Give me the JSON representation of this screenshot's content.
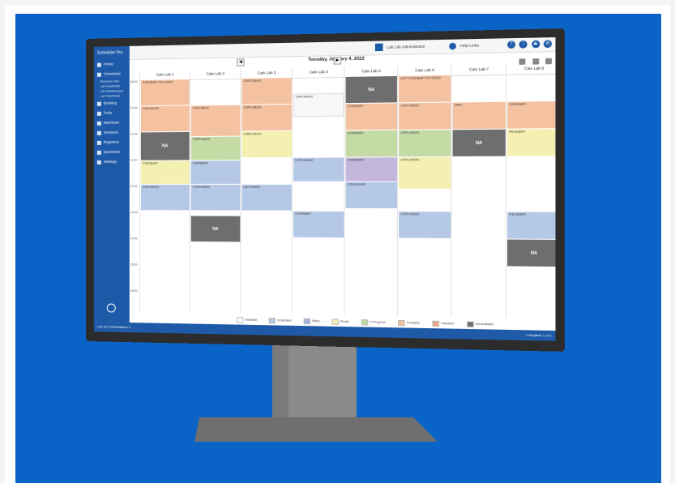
{
  "colors": {
    "backdrop": "#0a64c8",
    "sidebar": "#1e5aa8",
    "orange": "#f4c2a0",
    "green": "#c4dba6",
    "yellow": "#f3f0b1",
    "blue": "#b5c8e6",
    "purple": "#c4b7dc",
    "gray_na": "#6e6e6e"
  },
  "app": {
    "logo": "Scheduler Pro",
    "user_label": "Lab Lab Administrator",
    "help_label": "Help Links",
    "top_icons": [
      "?",
      "i",
      "⏏",
      "⚙"
    ]
  },
  "sidebar": {
    "items": [
      {
        "label": "Home",
        "icon": "home-icon"
      },
      {
        "label": "Schedules",
        "icon": "calendar-icon"
      },
      {
        "label": "Booking",
        "icon": "booking-icon"
      },
      {
        "label": "Tools",
        "icon": "tools-icon"
      },
      {
        "label": "Machines",
        "icon": "machine-icon"
      },
      {
        "label": "Sessions",
        "icon": "sessions-icon"
      },
      {
        "label": "Registers",
        "icon": "register-icon"
      },
      {
        "label": "Questions",
        "icon": "question-icon"
      },
      {
        "label": "Settings",
        "icon": "settings-icon"
      }
    ],
    "subitems": [
      "Resource View",
      "Lab View/Editor",
      "Lab View/Request",
      "Lab View/Panel"
    ]
  },
  "toolbar": {
    "date": "Tuesday, January 4, 2022",
    "prev": "◀",
    "next": "▶"
  },
  "times": [
    "08:00",
    "09:00",
    "10:00",
    "11:00",
    "12:00",
    "13:00",
    "14:00",
    "15:00",
    "16:00"
  ],
  "columns": [
    "Catv Lab 1",
    "Catv Lab 2",
    "Catv Lab 3",
    "Catv Lab 4",
    "Catv Lab 5",
    "Catv Lab 6",
    "Catv Lab 7",
    "Catv Lab 8"
  ],
  "legend": [
    {
      "label": "Available",
      "color": "#ffffff"
    },
    {
      "label": "Scheduled",
      "color": "#b5c8e6"
    },
    {
      "label": "Setup",
      "color": "#9fb3d6"
    },
    {
      "label": "Ready",
      "color": "#f3f0b1"
    },
    {
      "label": "In Progress",
      "color": "#c4dba6"
    },
    {
      "label": "Complete",
      "color": "#f4c2a0"
    },
    {
      "label": "Canceled",
      "color": "#e8a98a"
    },
    {
      "label": "Not Available",
      "color": "#6e6e6e"
    }
  ],
  "blocks": [
    {
      "col": 0,
      "t": 0.0,
      "h": 1.0,
      "kind": "orange",
      "text": "CORONARY PCI STENT"
    },
    {
      "col": 0,
      "t": 1.0,
      "h": 1.0,
      "kind": "orange",
      "text": "CATH ANGIO"
    },
    {
      "col": 0,
      "t": 2.0,
      "h": 1.1,
      "kind": "na",
      "text": "NA"
    },
    {
      "col": 0,
      "t": 3.1,
      "h": 0.9,
      "kind": "yellow",
      "text": "CORONARY"
    },
    {
      "col": 0,
      "t": 4.0,
      "h": 1.0,
      "kind": "blue",
      "text": "CATH ANGIO"
    },
    {
      "col": 1,
      "t": 1.0,
      "h": 1.2,
      "kind": "orange",
      "text": "CATH ANGIO"
    },
    {
      "col": 1,
      "t": 2.2,
      "h": 0.9,
      "kind": "green",
      "text": "CORO ANGIO"
    },
    {
      "col": 1,
      "t": 3.1,
      "h": 0.9,
      "kind": "blue",
      "text": "CORONARY"
    },
    {
      "col": 1,
      "t": 4.0,
      "h": 1.0,
      "kind": "blue",
      "text": "CORO ANGIO"
    },
    {
      "col": 1,
      "t": 5.2,
      "h": 1.0,
      "kind": "na",
      "text": "NA"
    },
    {
      "col": 2,
      "t": 0.0,
      "h": 1.0,
      "kind": "orange",
      "text": "CORO ANGIO"
    },
    {
      "col": 2,
      "t": 1.0,
      "h": 1.0,
      "kind": "orange",
      "text": "CORO ANGIO"
    },
    {
      "col": 2,
      "t": 2.0,
      "h": 1.0,
      "kind": "yellow",
      "text": "CORO ANGIO"
    },
    {
      "col": 2,
      "t": 4.0,
      "h": 1.0,
      "kind": "blue",
      "text": "CATH ANGIO"
    },
    {
      "col": 3,
      "t": 0.6,
      "h": 0.9,
      "kind": "white",
      "text": "CATH ANGIO"
    },
    {
      "col": 3,
      "t": 3.0,
      "h": 0.9,
      "kind": "blue",
      "text": "CORO ANGIO"
    },
    {
      "col": 3,
      "t": 5.0,
      "h": 1.0,
      "kind": "blue",
      "text": "CORONARY"
    },
    {
      "col": 4,
      "t": 0.0,
      "h": 1.0,
      "kind": "na",
      "text": "NA"
    },
    {
      "col": 4,
      "t": 1.0,
      "h": 1.0,
      "kind": "orange",
      "text": "CORONARY"
    },
    {
      "col": 4,
      "t": 2.0,
      "h": 1.0,
      "kind": "green",
      "text": "CORONARY"
    },
    {
      "col": 4,
      "t": 3.0,
      "h": 0.9,
      "kind": "purple",
      "text": "CORONARY"
    },
    {
      "col": 4,
      "t": 3.9,
      "h": 1.0,
      "kind": "blue",
      "text": "CORO ANGIO"
    },
    {
      "col": 5,
      "t": 0.0,
      "h": 1.0,
      "kind": "orange",
      "text": "LEFT CORONARY PCI STENT"
    },
    {
      "col": 5,
      "t": 1.0,
      "h": 1.0,
      "kind": "orange",
      "text": "CORO ANGIO"
    },
    {
      "col": 5,
      "t": 2.0,
      "h": 1.0,
      "kind": "green",
      "text": "CORO ANGIO"
    },
    {
      "col": 5,
      "t": 3.0,
      "h": 1.2,
      "kind": "yellow",
      "text": "CORO ANGIO"
    },
    {
      "col": 5,
      "t": 5.0,
      "h": 1.0,
      "kind": "blue",
      "text": "CORO ANGIO"
    },
    {
      "col": 6,
      "t": 1.0,
      "h": 1.0,
      "kind": "orange",
      "text": "TAVR"
    },
    {
      "col": 6,
      "t": 2.0,
      "h": 1.0,
      "kind": "na",
      "text": "NA"
    },
    {
      "col": 7,
      "t": 1.0,
      "h": 1.0,
      "kind": "orange",
      "text": "CORONARY"
    },
    {
      "col": 7,
      "t": 2.0,
      "h": 1.0,
      "kind": "yellow",
      "text": "PM INSERT"
    },
    {
      "col": 7,
      "t": 5.0,
      "h": 1.0,
      "kind": "blue",
      "text": "ICD INSERT"
    },
    {
      "col": 7,
      "t": 6.0,
      "h": 1.0,
      "kind": "na",
      "text": "NA"
    }
  ],
  "status": {
    "left": "Lab 10.2 Workstation 1",
    "right": "Complete 1 of 1"
  }
}
